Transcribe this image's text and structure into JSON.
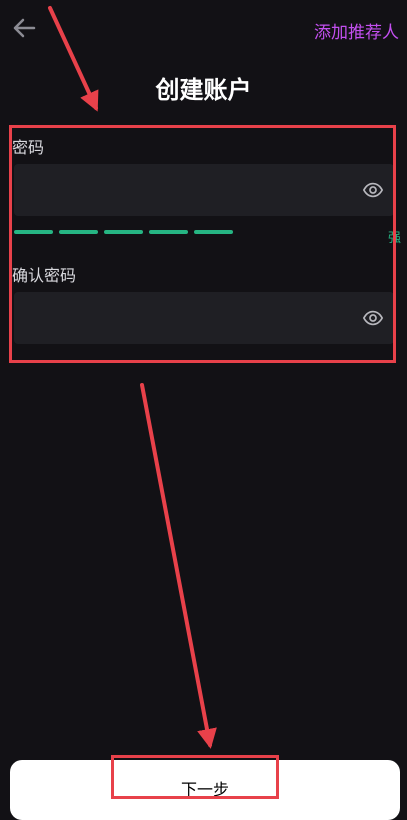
{
  "header": {
    "back_icon": "arrow-left-icon",
    "referrer_link": "添加推荐人"
  },
  "page": {
    "title": "创建账户"
  },
  "password": {
    "label": "密码",
    "value": "",
    "visibility_icon": "eye-icon"
  },
  "strength": {
    "segments_filled": 5,
    "segments_total": 5,
    "label": "强",
    "color": "#26b583"
  },
  "confirm_password": {
    "label": "确认密码",
    "value": "",
    "visibility_icon": "eye-icon"
  },
  "footer": {
    "next_label": "下一步"
  },
  "colors": {
    "background": "#121115",
    "accent": "#c34ff0",
    "annotation": "#e8414a",
    "field": "#1f1f24"
  }
}
